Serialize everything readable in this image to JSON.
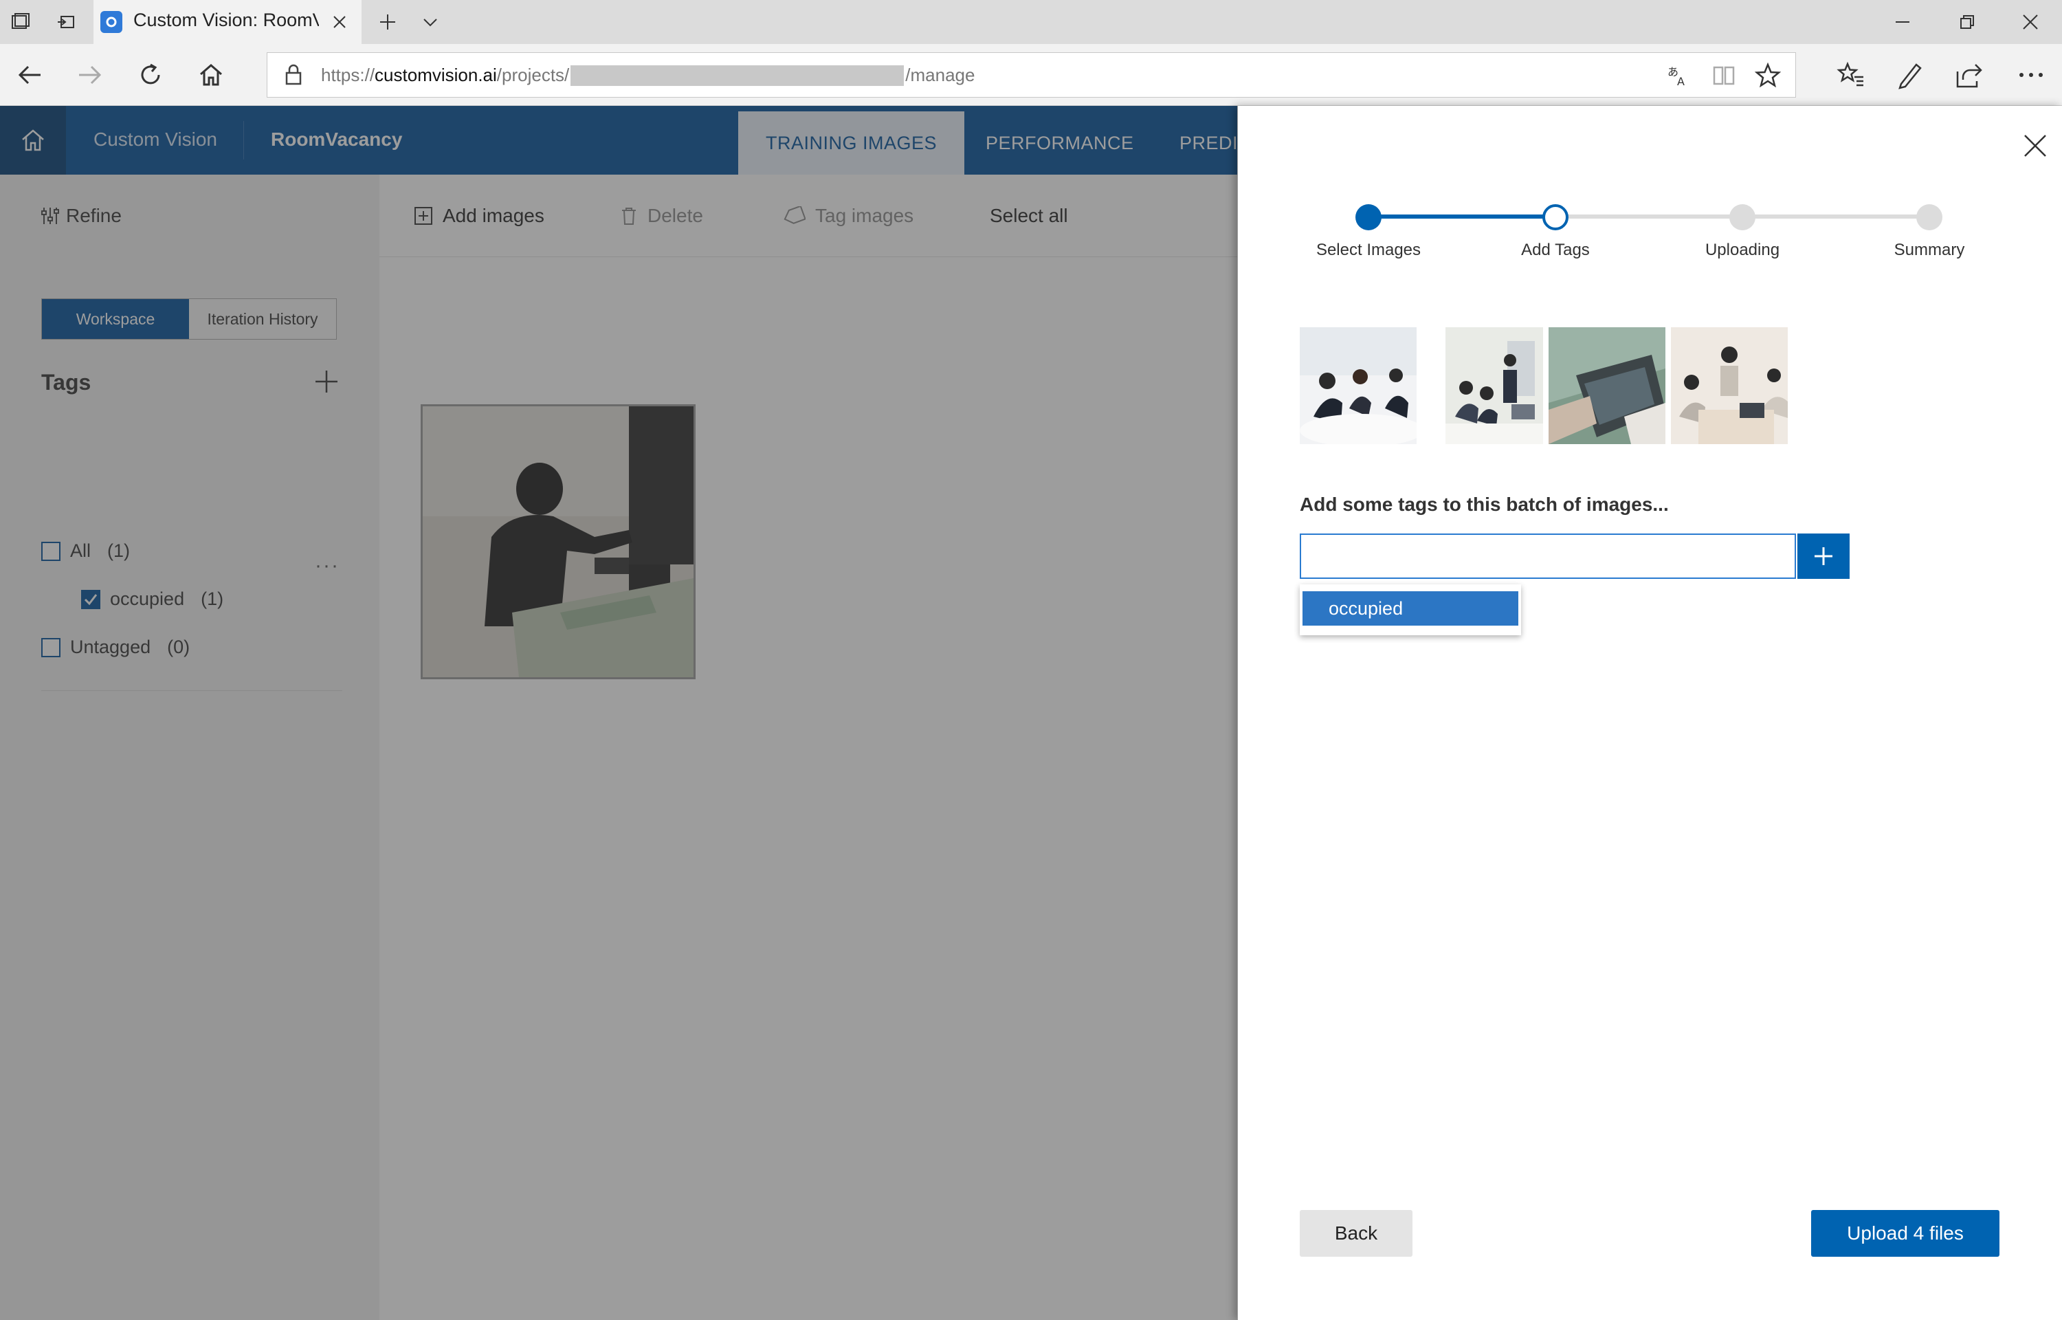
{
  "browser": {
    "tab_title": "Custom Vision: RoomVa",
    "url_prefix": "https://",
    "url_host": "customvision.ai",
    "url_path1": "/projects/",
    "url_path2": "/manage"
  },
  "app": {
    "brand": "Custom Vision",
    "project": "RoomVacancy",
    "tabs": [
      {
        "label": "TRAINING IMAGES",
        "active": true
      },
      {
        "label": "PERFORMANCE",
        "active": false
      },
      {
        "label": "PREDIC",
        "active": false
      }
    ]
  },
  "sidebar": {
    "refine": "Refine",
    "segments": [
      "Workspace",
      "Iteration History"
    ],
    "tags_title": "Tags",
    "tags": [
      {
        "label": "All",
        "count": "(1)",
        "checked": false
      },
      {
        "label": "occupied",
        "count": "(1)",
        "checked": true
      },
      {
        "label": "Untagged",
        "count": "(0)",
        "checked": false
      }
    ],
    "more": "···"
  },
  "toolbar": {
    "add_images": "Add images",
    "delete": "Delete",
    "tag_images": "Tag images",
    "select_all": "Select all"
  },
  "panel": {
    "steps": [
      "Select Images",
      "Add Tags",
      "Uploading",
      "Summary"
    ],
    "current_step": 1,
    "prompt": "Add some tags to this batch of images...",
    "tag_input_value": "",
    "suggestion": "occupied",
    "back_label": "Back",
    "upload_label": "Upload 4 files"
  },
  "colors": {
    "brand_blue": "#004f98",
    "button_blue": "#0063b1",
    "step_active": "#0063b1",
    "step_inactive": "#d9d9d9"
  }
}
